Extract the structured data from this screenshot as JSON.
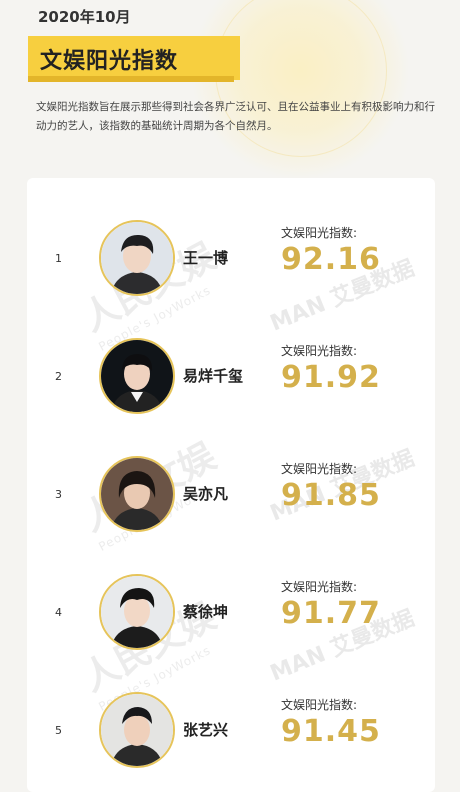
{
  "header": {
    "date": "2020年10月",
    "title": "文娱阳光指数",
    "description": "文娱阳光指数旨在展示那些得到社会各界广泛认可、且在公益事业上有积极影响力和行动力的艺人，该指数的基础统计周期为各个自然月。"
  },
  "watermarks": {
    "logo_text": "人民文娱",
    "logo_subtext": "People's JoyWorks",
    "data_text": "MAN 艾曼数据"
  },
  "ranking": [
    {
      "rank": "1",
      "name": "王一博",
      "label": "文娱阳光指数:",
      "score": "92.16"
    },
    {
      "rank": "2",
      "name": "易烊千玺",
      "label": "文娱阳光指数:",
      "score": "91.92"
    },
    {
      "rank": "3",
      "name": "吴亦凡",
      "label": "文娱阳光指数:",
      "score": "91.85"
    },
    {
      "rank": "4",
      "name": "蔡徐坤",
      "label": "文娱阳光指数:",
      "score": "91.77"
    },
    {
      "rank": "5",
      "name": "张艺兴",
      "label": "文娱阳光指数:",
      "score": "91.45"
    }
  ],
  "colors": {
    "accent": "#f7cf3f",
    "score": "#d4b04c",
    "avatar_border": "#e6c45a"
  }
}
